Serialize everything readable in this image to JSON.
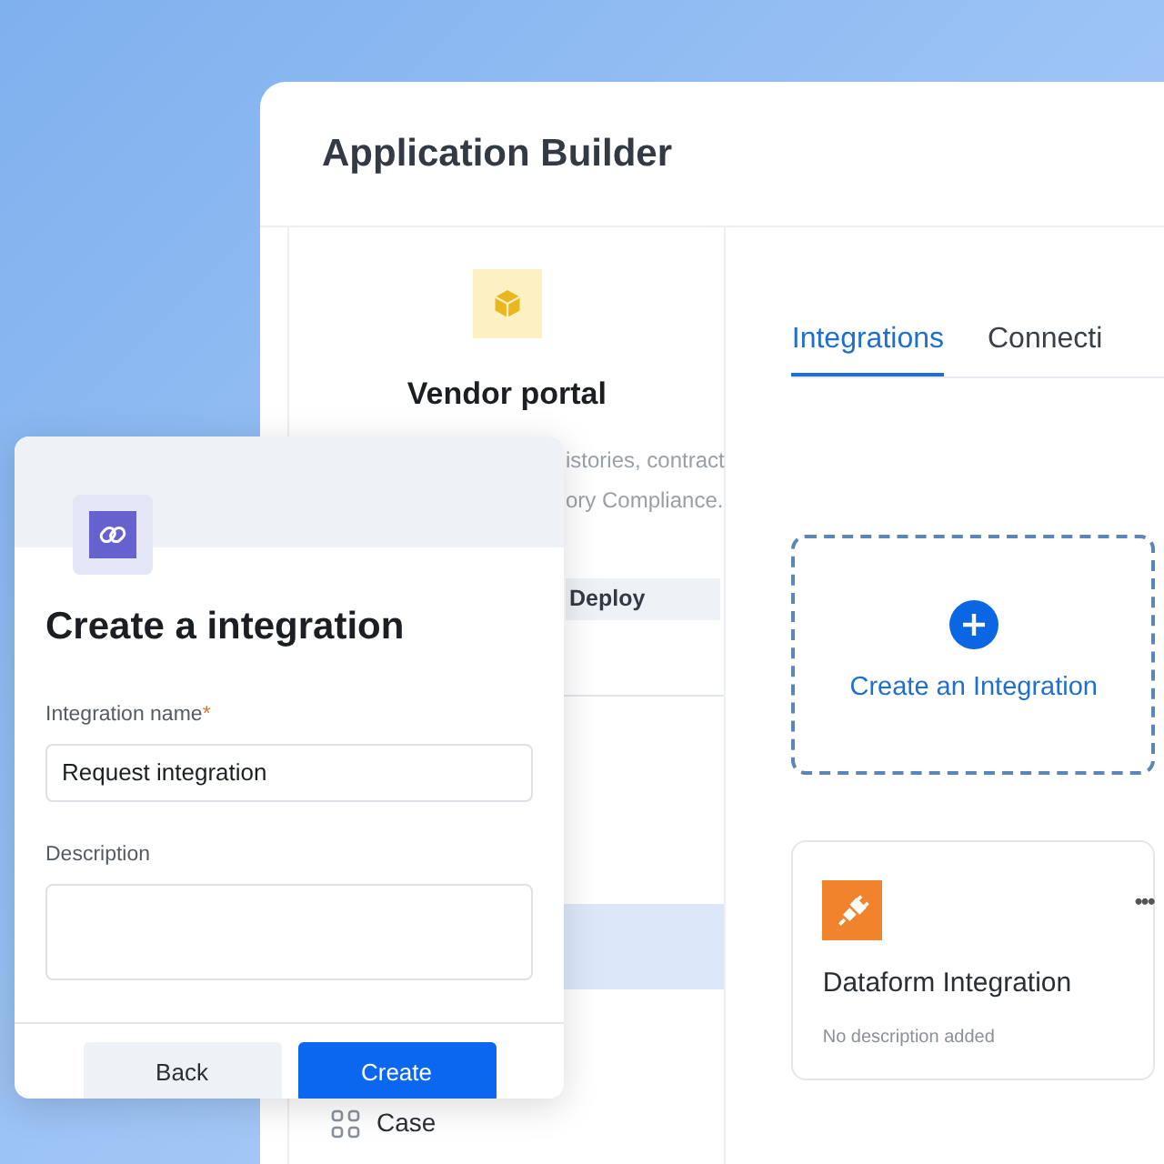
{
  "window": {
    "title": "Application Builder"
  },
  "app_panel": {
    "name": "Vendor portal",
    "description_lines": [
      "istories, contract",
      "ory Compliance."
    ],
    "deploy_button": "Deploy"
  },
  "nav_items": [
    {
      "selected": true
    },
    {
      "label": "Case",
      "selected": false
    }
  ],
  "tabs": [
    {
      "label": "Integrations",
      "selected": true
    },
    {
      "label": "Connecti",
      "selected": false
    }
  ],
  "create_card": {
    "label": "Create an Integration"
  },
  "integration_cards": [
    {
      "title": "Dataform Integration",
      "description": "No description added",
      "menu": "•••"
    }
  ],
  "dialog": {
    "title": "Create a integration",
    "name_label": "Integration name",
    "required_mark": "*",
    "name_value": "Request integration",
    "description_label": "Description",
    "buttons": [
      {
        "label": "Back",
        "kind": "secondary"
      },
      {
        "label": "Create",
        "kind": "primary"
      }
    ]
  }
}
